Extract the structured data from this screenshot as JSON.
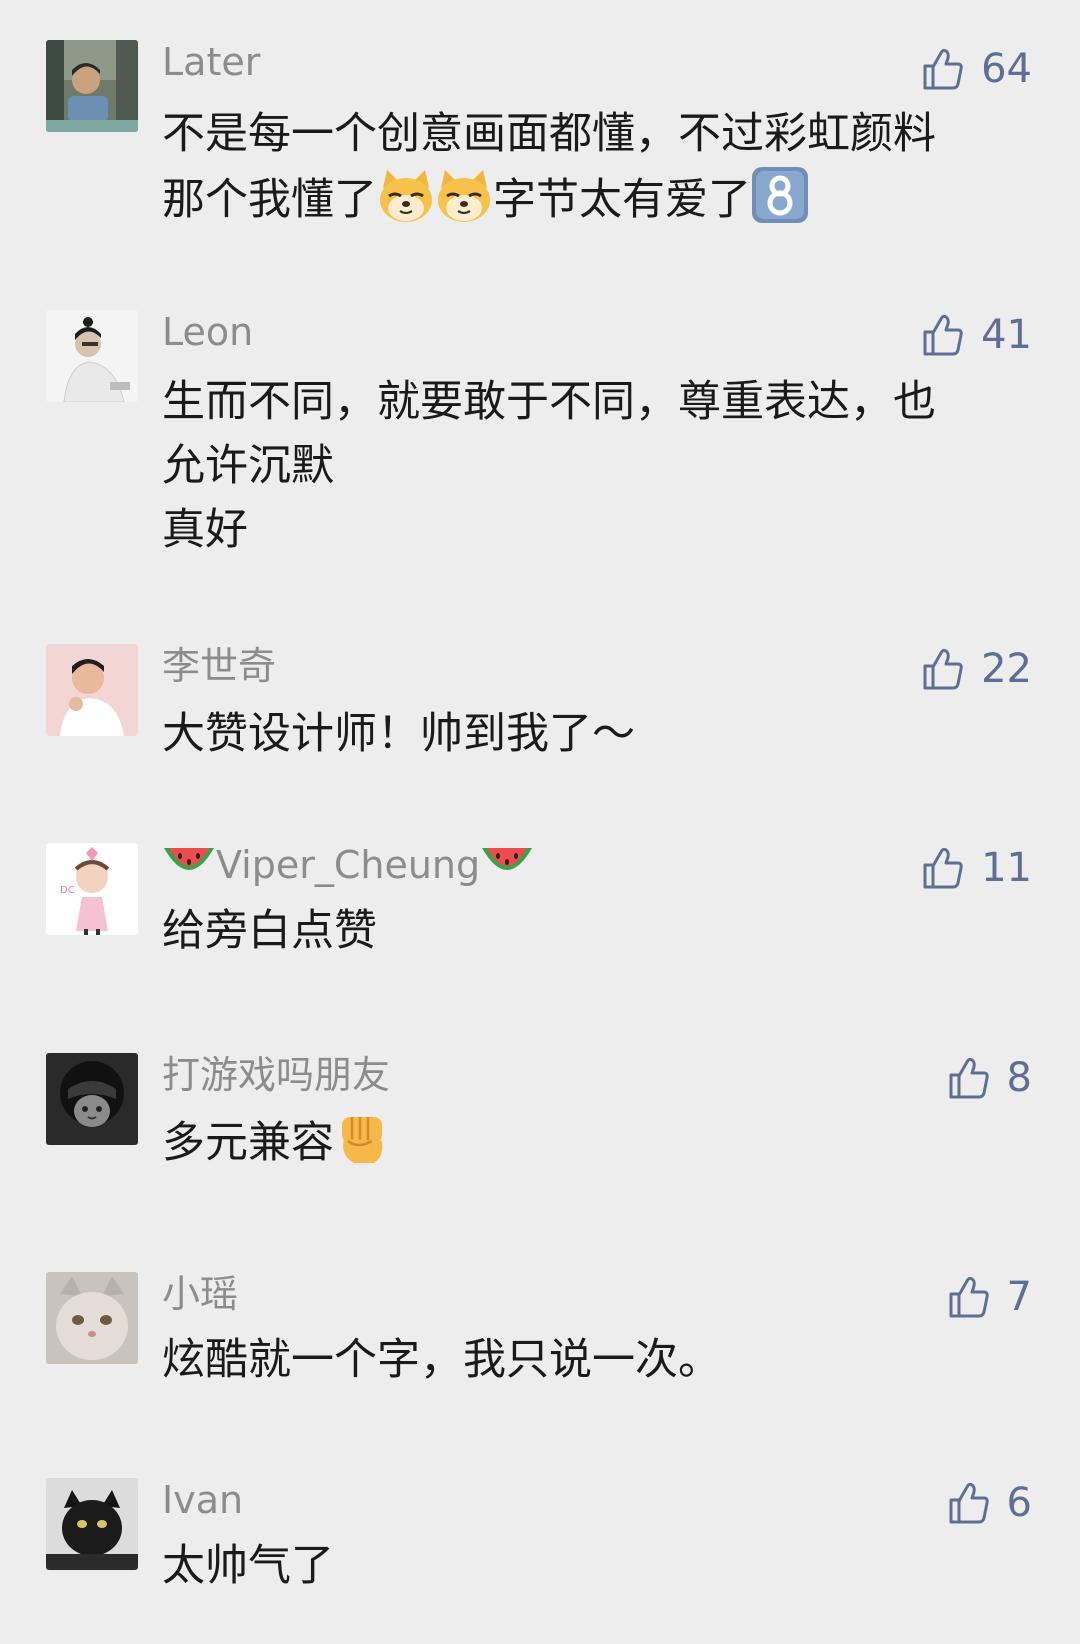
{
  "comments": [
    {
      "name": "Later",
      "likes": "64",
      "lines": [
        "不是每一个创意画面都懂，不过彩虹颜料",
        "那个我懂了"
      ],
      "line2_suffix": "字节太有爱了",
      "emojis": [
        "doge-emoji",
        "doge-emoji",
        "keycap-8-emoji"
      ]
    },
    {
      "name": "Leon",
      "likes": "41",
      "lines": [
        "生而不同，就要敢于不同，尊重表达，也",
        "允许沉默",
        "真好"
      ]
    },
    {
      "name": "李世奇",
      "likes": "22",
      "lines": [
        "大赞设计师！帅到我了～"
      ]
    },
    {
      "name": "Viper_Cheung",
      "likes": "11",
      "lines": [
        "给旁白点赞"
      ],
      "emojis": [
        "watermelon-emoji",
        "watermelon-emoji"
      ]
    },
    {
      "name": "打游戏吗朋友",
      "likes": "8",
      "lines": [
        "多元兼容"
      ],
      "emojis": [
        "fist-emoji"
      ]
    },
    {
      "name": "小瑶",
      "likes": "7",
      "lines": [
        "炫酷就一个字，我只说一次。"
      ]
    },
    {
      "name": "Ivan",
      "likes": "6",
      "lines": [
        "太帅气了"
      ]
    }
  ],
  "icons": {
    "like": "thumbs-up-icon"
  },
  "colors": {
    "background": "#ededed",
    "name": "#8c8c8c",
    "text": "#1a1a1a",
    "like": "#5e6e94"
  }
}
